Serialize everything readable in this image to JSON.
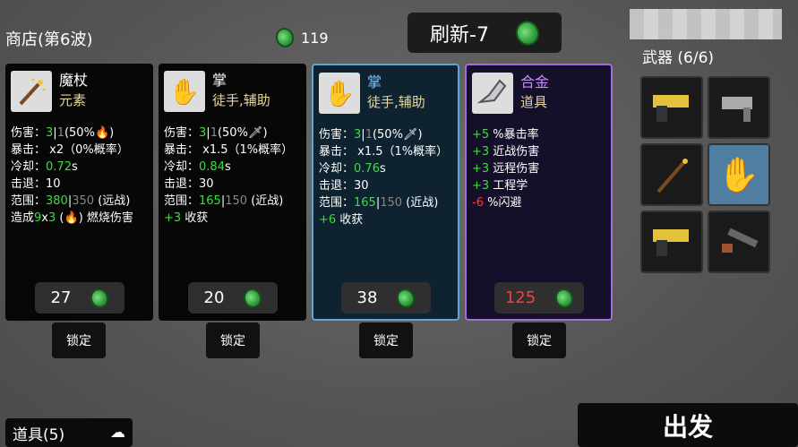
{
  "shop": {
    "title": "商店(第6波)",
    "coins": "119"
  },
  "refresh": {
    "label": "刷新-7"
  },
  "cards": [
    {
      "name": "魔杖",
      "type": "元素",
      "price": "27",
      "lock": "锁定",
      "stats": {
        "damage_label": "伤害：",
        "damage_a": "3",
        "damage_b": "1",
        "damage_rest": "(50%",
        "crit": "暴击： x2（0%概率）",
        "cooldown_label": "冷却：",
        "cooldown": "0.72",
        "cooldown_unit": "s",
        "knockback": "击退：10",
        "range_label": "范围：",
        "range_a": "380",
        "range_b": "350",
        "range_rest": " (远战)",
        "burn_a": "造成",
        "burn_b": "9",
        "burn_c": "x",
        "burn_d": "3",
        "burn_e": " (",
        "burn_f": ")  燃烧伤害"
      }
    },
    {
      "name": "掌",
      "type": "徒手,辅助",
      "price": "20",
      "lock": "锁定",
      "stats": {
        "damage_label": "伤害：",
        "damage_a": "3",
        "damage_b": "1",
        "damage_rest": "(50%",
        "crit": "暴击： x1.5（1%概率）",
        "cooldown_label": "冷却：",
        "cooldown": "0.84",
        "cooldown_unit": "s",
        "knockback": "击退：30",
        "range_label": "范围：",
        "range_a": "165",
        "range_b": "150",
        "range_rest": " (近战)",
        "bonus_a": "+3",
        "bonus_b": " 收获"
      }
    },
    {
      "name": "掌",
      "type": "徒手,辅助",
      "price": "38",
      "lock": "锁定",
      "stats": {
        "damage_label": "伤害：",
        "damage_a": "3",
        "damage_b": "1",
        "damage_rest": "(50%",
        "crit": "暴击： x1.5（1%概率）",
        "cooldown_label": "冷却：",
        "cooldown": "0.76",
        "cooldown_unit": "s",
        "knockback": "击退：30",
        "range_label": "范围：",
        "range_a": "165",
        "range_b": "150",
        "range_rest": " (近战)",
        "bonus_a": "+6",
        "bonus_b": " 收获"
      }
    },
    {
      "name": "合金",
      "type": "道具",
      "price": "125",
      "lock": "锁定",
      "lines": [
        {
          "val": "+5",
          "text": " %暴击率",
          "color": "green"
        },
        {
          "val": "+3",
          "text": " 近战伤害",
          "color": "green"
        },
        {
          "val": "+3",
          "text": " 远程伤害",
          "color": "green"
        },
        {
          "val": "+3",
          "text": " 工程学",
          "color": "green"
        },
        {
          "val": "-6",
          "text": " %闪避",
          "color": "red"
        }
      ]
    }
  ],
  "weapons": {
    "title": "武器 (6/6)",
    "slots": [
      "taser-icon",
      "smg-icon",
      "wand-icon",
      "palm-icon",
      "taser-icon",
      "shotgun-icon"
    ]
  },
  "items_bar": {
    "label": "道具(5)"
  },
  "go_button": {
    "label": "出发"
  }
}
